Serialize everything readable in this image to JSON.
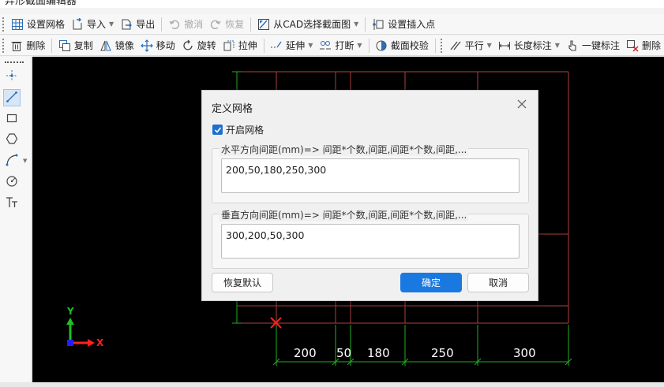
{
  "window": {
    "title": "异形截面编辑器"
  },
  "toolbar1": {
    "items": [
      {
        "label": "设置网格",
        "icon": "grid-icon"
      },
      {
        "label": "导入",
        "icon": "import-icon",
        "dropdown": true
      },
      {
        "label": "导出",
        "icon": "export-icon"
      },
      {
        "label": "撤消",
        "icon": "undo-icon",
        "disabled": true
      },
      {
        "label": "恢复",
        "icon": "redo-icon",
        "disabled": true
      },
      {
        "label": "从CAD选择截面图",
        "icon": "cad-select-icon",
        "dropdown": true
      },
      {
        "label": "设置插入点",
        "icon": "insert-point-icon"
      }
    ]
  },
  "toolbar2": {
    "items": [
      {
        "label": "删除",
        "icon": "trash-icon"
      },
      {
        "label": "复制",
        "icon": "copy-icon"
      },
      {
        "label": "镜像",
        "icon": "mirror-icon"
      },
      {
        "label": "移动",
        "icon": "move-icon"
      },
      {
        "label": "旋转",
        "icon": "rotate-icon"
      },
      {
        "label": "拉伸",
        "icon": "stretch-icon"
      },
      {
        "label": "延伸",
        "icon": "extend-icon",
        "dropdown": true
      },
      {
        "label": "打断",
        "icon": "break-icon",
        "dropdown": true
      },
      {
        "label": "截面校验",
        "icon": "section-check-icon"
      },
      {
        "label": "平行",
        "icon": "parallel-icon",
        "dropdown": true
      },
      {
        "label": "长度标注",
        "icon": "length-dimension-icon",
        "dropdown": true
      },
      {
        "label": "一键标注",
        "icon": "auto-dimension-icon"
      },
      {
        "label": "删除",
        "icon": "delete-dimension-icon"
      }
    ]
  },
  "canvas": {
    "axis": {
      "y": "Y",
      "x": "X"
    },
    "dimensions": [
      "200",
      "50",
      "180",
      "250",
      "300"
    ],
    "colors": {
      "background": "#000000",
      "grid": "#b04040",
      "dim": "#20b020",
      "origin": "#ff2020"
    }
  },
  "dialog": {
    "title": "定义网格",
    "enable_grid_label": "开启网格",
    "enable_grid_checked": true,
    "horizontal_label": "水平方向间距(mm)=> 间距*个数,间距,间距*个数,间距,...",
    "horizontal_value": "200,50,180,250,300",
    "vertical_label": "垂直方向间距(mm)=> 间距*个数,间距,间距*个数,间距,...",
    "vertical_value": "300,200,50,300",
    "reset_label": "恢复默认",
    "ok_label": "确定",
    "cancel_label": "取消"
  }
}
